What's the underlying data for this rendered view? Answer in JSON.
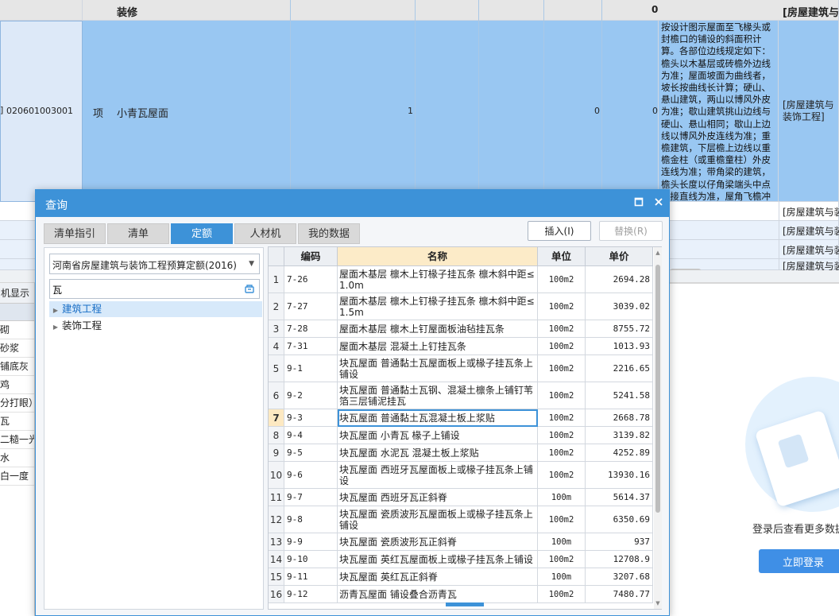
{
  "spreadsheet": {
    "header_row": {
      "name": "装修",
      "value": "0",
      "section": "[房屋建筑与"
    },
    "selected_row": {
      "code": "020601003001",
      "type": "项",
      "name": "小青瓦屋面",
      "qty": "1",
      "price": "0",
      "total": "0",
      "rule": "按设计图示屋面至飞椽头或封檐口的铺设的斜面积计算。各部位边线规定如下：檐头以木基层或砖檐外边线为准；屋面坡面为曲线者，坡长按曲线长计算；硬山、悬山建筑，两山以博风外皮为准；歇山建筑挑山边线与硬山、悬山相同；歇山上边线以博风外皮连线为准；重檐建筑，下层檐上边线以重檐金柱（或重檐童柱）外皮连线为准；带角梁的建筑，檐头长度以仔角梁端头中点连接直线为准，屋角飞檐冲出部分面积不增加",
      "section": "[房屋建筑与装饰工程]"
    },
    "rows_below": [
      "[房屋建筑与装",
      "[房屋建筑与装",
      "[房屋建筑与装",
      "[房屋建筑与装"
    ]
  },
  "left_panel": {
    "header": "机显示",
    "items": [
      "砌",
      "砂浆",
      "铺底灰",
      "鸡",
      "分打眼）",
      "瓦",
      "二糙一光",
      "水",
      "白一度"
    ]
  },
  "right_panel": {
    "login_prompt": "登录后查看更多数据",
    "login_button": "立即登录"
  },
  "dialog": {
    "title": "查询",
    "tabs": [
      "清单指引",
      "清单",
      "定额",
      "人材机",
      "我的数据"
    ],
    "active_tab": "定额",
    "insert_button": "插入(I)",
    "replace_button": "替换(R)",
    "quota_library": "河南省房屋建筑与装饰工程预算定额(2016)",
    "search_value": "瓦",
    "tree": [
      {
        "label": "建筑工程",
        "selected": true
      },
      {
        "label": "装饰工程",
        "selected": false
      }
    ],
    "columns": [
      "编码",
      "名称",
      "单位",
      "单价"
    ],
    "rows": [
      {
        "no": "1",
        "code": "7-26",
        "name": "屋面木基层 檩木上钉椽子挂瓦条 檩木斜中距≤1.0m",
        "unit": "100m2",
        "price": "2694.28"
      },
      {
        "no": "2",
        "code": "7-27",
        "name": "屋面木基层 檩木上钉椽子挂瓦条 檩木斜中距≤1.5m",
        "unit": "100m2",
        "price": "3039.02"
      },
      {
        "no": "3",
        "code": "7-28",
        "name": "屋面木基层 檩木上钉屋面板油毡挂瓦条",
        "unit": "100m2",
        "price": "8755.72"
      },
      {
        "no": "4",
        "code": "7-31",
        "name": "屋面木基层 混凝土上钉挂瓦条",
        "unit": "100m2",
        "price": "1013.93"
      },
      {
        "no": "5",
        "code": "9-1",
        "name": "块瓦屋面 普通黏土瓦屋面板上或椽子挂瓦条上铺设",
        "unit": "100m2",
        "price": "2216.65"
      },
      {
        "no": "6",
        "code": "9-2",
        "name": "块瓦屋面 普通黏土瓦钢、混凝土檩条上铺钉苇箔三层铺泥挂瓦",
        "unit": "100m2",
        "price": "5241.58"
      },
      {
        "no": "7",
        "code": "9-3",
        "name": "块瓦屋面 普通黏土瓦混凝土板上浆贴",
        "unit": "100m2",
        "price": "2668.78"
      },
      {
        "no": "8",
        "code": "9-4",
        "name": "块瓦屋面 小青瓦 椽子上铺设",
        "unit": "100m2",
        "price": "3139.82"
      },
      {
        "no": "9",
        "code": "9-5",
        "name": "块瓦屋面 水泥瓦 混凝土板上浆贴",
        "unit": "100m2",
        "price": "4252.89"
      },
      {
        "no": "10",
        "code": "9-6",
        "name": "块瓦屋面 西班牙瓦屋面板上或椽子挂瓦条上铺设",
        "unit": "100m2",
        "price": "13930.16"
      },
      {
        "no": "11",
        "code": "9-7",
        "name": "块瓦屋面 西班牙瓦正斜脊",
        "unit": "100m",
        "price": "5614.37"
      },
      {
        "no": "12",
        "code": "9-8",
        "name": "块瓦屋面 瓷质波形瓦屋面板上或椽子挂瓦条上铺设",
        "unit": "100m2",
        "price": "6350.69"
      },
      {
        "no": "13",
        "code": "9-9",
        "name": "块瓦屋面 瓷质波形瓦正斜脊",
        "unit": "100m",
        "price": "937"
      },
      {
        "no": "14",
        "code": "9-10",
        "name": "块瓦屋面 英红瓦屋面板上或椽子挂瓦条上铺设",
        "unit": "100m2",
        "price": "12708.9"
      },
      {
        "no": "15",
        "code": "9-11",
        "name": "块瓦屋面 英红瓦正斜脊",
        "unit": "100m",
        "price": "3207.68"
      },
      {
        "no": "16",
        "code": "9-12",
        "name": "沥青瓦屋面 铺设叠合沥青瓦",
        "unit": "100m2",
        "price": "7480.77"
      }
    ],
    "current_row": "7"
  }
}
